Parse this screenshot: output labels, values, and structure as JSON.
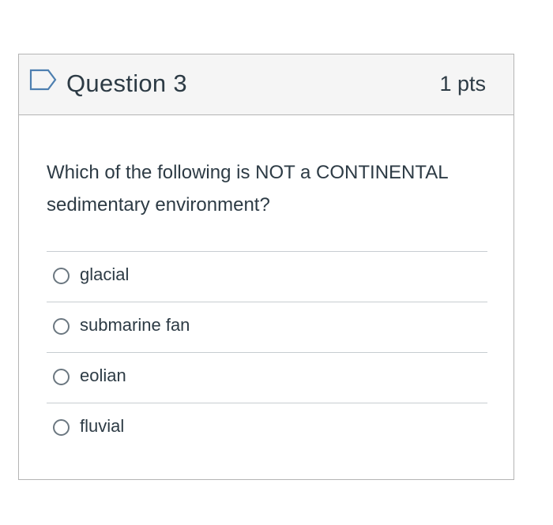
{
  "question": {
    "title": "Question 3",
    "points": "1 pts",
    "text": "Which of the following is NOT a CONTINENTAL sedimentary environment?",
    "flag_icon": "flag-outline-icon",
    "answers": [
      {
        "label": "glacial",
        "selected": false
      },
      {
        "label": "submarine fan",
        "selected": false
      },
      {
        "label": "eolian",
        "selected": false
      },
      {
        "label": "fluvial",
        "selected": false
      }
    ]
  },
  "colors": {
    "header_bg": "#f5f5f5",
    "border": "#b4b4b4",
    "text": "#2d3b45",
    "flag": "#4d7fb0"
  }
}
